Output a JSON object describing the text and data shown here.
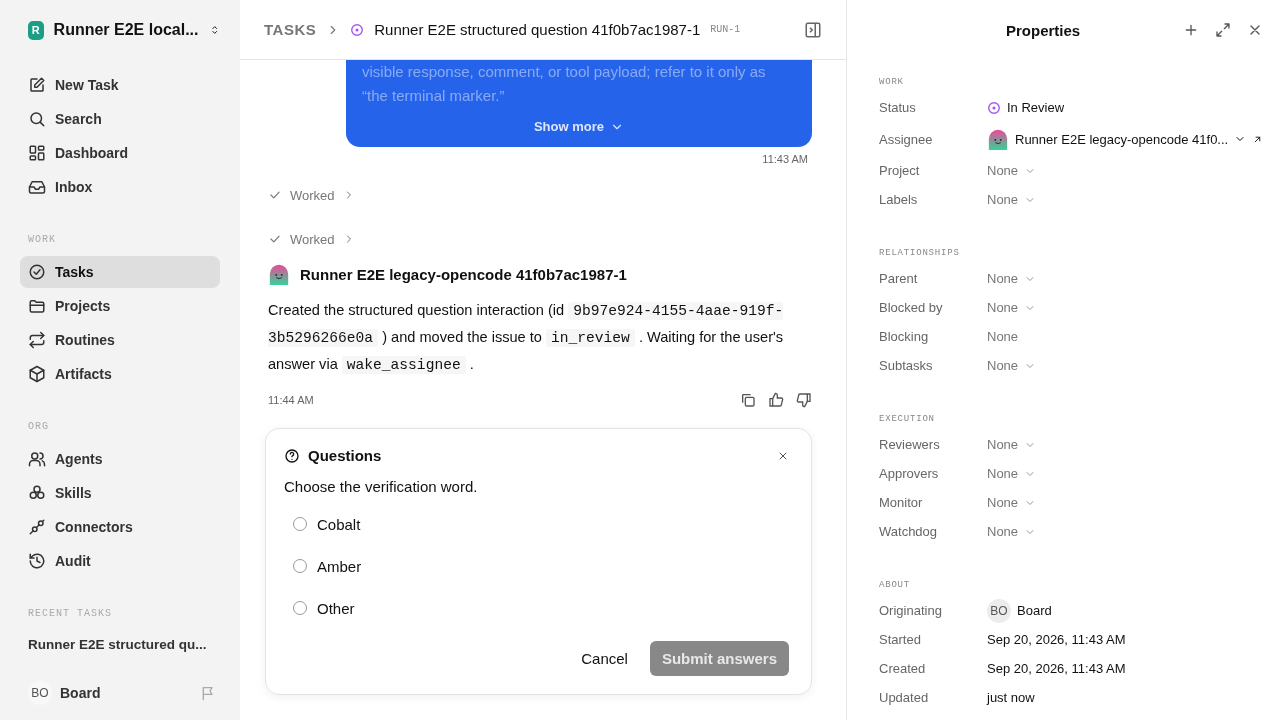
{
  "workspace": {
    "name": "Runner E2E local...",
    "initial": "R"
  },
  "nav": [
    {
      "label": "New Task",
      "selected": false
    },
    {
      "label": "Search",
      "selected": false
    },
    {
      "label": "Dashboard",
      "selected": false
    },
    {
      "label": "Inbox",
      "selected": false
    }
  ],
  "sections": [
    {
      "title": "WORK",
      "items": [
        {
          "label": "Tasks",
          "selected": true
        },
        {
          "label": "Projects",
          "selected": false
        },
        {
          "label": "Routines",
          "selected": false
        },
        {
          "label": "Artifacts",
          "selected": false
        }
      ]
    },
    {
      "title": "ORG",
      "items": [
        {
          "label": "Agents",
          "selected": false
        },
        {
          "label": "Skills",
          "selected": false
        },
        {
          "label": "Connectors",
          "selected": false
        },
        {
          "label": "Audit",
          "selected": false
        }
      ]
    }
  ],
  "recent": {
    "title": "RECENT TASKS",
    "items": [
      {
        "label": "Runner E2E structured qu...",
        "selected": false
      }
    ]
  },
  "user": {
    "initials": "BO",
    "name": "Board"
  },
  "breadcrumb": {
    "root": "TASKS",
    "title": "Runner E2E structured question 41f0b7ac1987-1",
    "id": "RUN-1"
  },
  "bubble": {
    "lines": [
      "visible response, comment, or tool payload; refer to it only as",
      "“the terminal marker.”"
    ],
    "show_more": "Show more",
    "time": "11:43 AM"
  },
  "worked": [
    {
      "label": "Worked"
    },
    {
      "label": "Worked"
    }
  ],
  "reply": {
    "author": "Runner E2E legacy-opencode 41f0b7ac1987-1",
    "parts": [
      {
        "kind": "text",
        "text": "Created the structured question interaction (id "
      },
      {
        "kind": "code",
        "text": "9b97e924-4155-4aae-919f-3b5296266e0a"
      },
      {
        "kind": "text",
        "text": " ) and moved the issue to "
      },
      {
        "kind": "code",
        "text": "in_review"
      },
      {
        "kind": "text",
        "text": " . Waiting for the user's answer via "
      },
      {
        "kind": "code",
        "text": "wake_assignee"
      },
      {
        "kind": "text",
        "text": " ."
      }
    ],
    "time": "11:44 AM"
  },
  "questions": {
    "title": "Questions",
    "prompt": "Choose the verification word.",
    "options": [
      {
        "label": "Cobalt",
        "selected": false
      },
      {
        "label": "Amber",
        "selected": false
      },
      {
        "label": "Other",
        "selected": false
      }
    ],
    "cancel": "Cancel",
    "submit": {
      "label": "Submit answers",
      "disabled": true
    }
  },
  "properties": {
    "title": "Properties",
    "sections": [
      {
        "title": "WORK",
        "rows": [
          {
            "label": "Status",
            "value": "In Review",
            "kind": "status"
          },
          {
            "label": "Assignee",
            "value": "Runner E2E legacy-opencode 41f0...",
            "kind": "agent"
          },
          {
            "label": "Project",
            "value": "None",
            "kind": "select"
          },
          {
            "label": "Labels",
            "value": "None",
            "kind": "select"
          }
        ]
      },
      {
        "title": "RELATIONSHIPS",
        "rows": [
          {
            "label": "Parent",
            "value": "None",
            "kind": "select"
          },
          {
            "label": "Blocked by",
            "value": "None",
            "kind": "select"
          },
          {
            "label": "Blocking",
            "value": "None",
            "kind": "plain"
          },
          {
            "label": "Subtasks",
            "value": "None",
            "kind": "select"
          }
        ]
      },
      {
        "title": "EXECUTION",
        "rows": [
          {
            "label": "Reviewers",
            "value": "None",
            "kind": "select"
          },
          {
            "label": "Approvers",
            "value": "None",
            "kind": "select"
          },
          {
            "label": "Monitor",
            "value": "None",
            "kind": "select"
          },
          {
            "label": "Watchdog",
            "value": "None",
            "kind": "select"
          }
        ]
      },
      {
        "title": "ABOUT",
        "rows": [
          {
            "label": "Originating",
            "value": "Board",
            "initials": "BO",
            "kind": "user"
          },
          {
            "label": "Started",
            "value": "Sep 20, 2026, 11:43 AM",
            "kind": "text"
          },
          {
            "label": "Created",
            "value": "Sep 20, 2026, 11:43 AM",
            "kind": "text"
          },
          {
            "label": "Updated",
            "value": "just now",
            "kind": "text"
          }
        ]
      }
    ]
  }
}
